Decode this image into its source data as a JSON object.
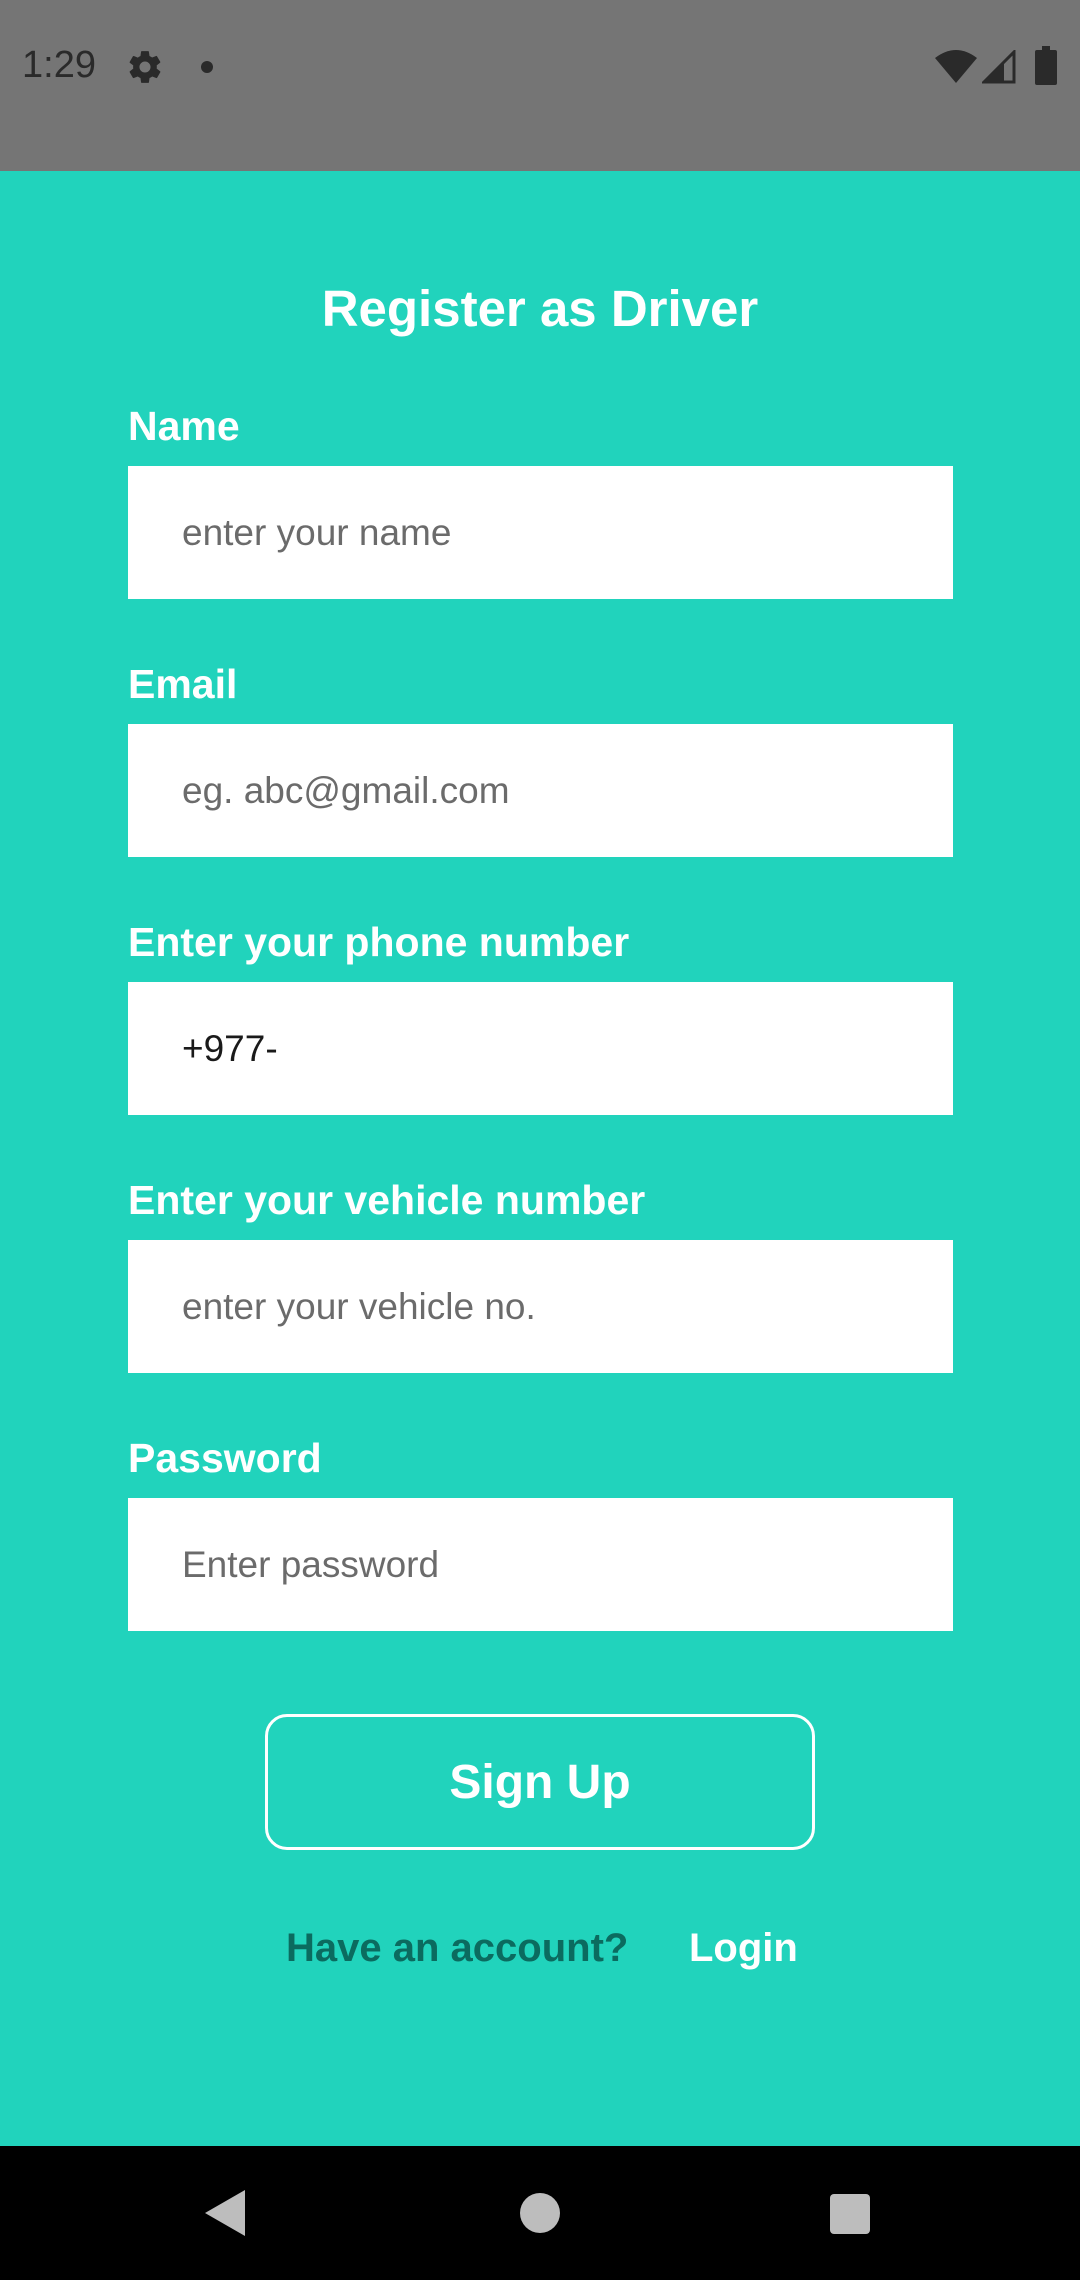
{
  "status_bar": {
    "time": "1:29",
    "icons": [
      "gear-icon",
      "notification-dot-icon",
      "wifi-icon",
      "signal-icon",
      "battery-icon"
    ]
  },
  "form": {
    "title": "Register as Driver",
    "fields": [
      {
        "label": "Name",
        "placeholder": "enter your name",
        "value": ""
      },
      {
        "label": "Email",
        "placeholder": "eg. abc@gmail.com",
        "value": ""
      },
      {
        "label": "Enter your phone number",
        "placeholder": "",
        "value": "+977-"
      },
      {
        "label": "Enter your vehicle number",
        "placeholder": "enter your vehicle no.",
        "value": ""
      },
      {
        "label": "Password",
        "placeholder": "Enter password",
        "value": ""
      }
    ],
    "signup_label": "Sign Up",
    "have_account_text": "Have an account?",
    "login_label": "Login"
  },
  "nav_bar": {
    "icons": [
      "back-icon",
      "home-icon",
      "recents-icon"
    ]
  },
  "colors": {
    "background": "#21d3bc",
    "status_bar": "#757575",
    "have_account_text": "#0b6b5f",
    "field_background": "#ffffff",
    "nav_bar": "#000000"
  }
}
